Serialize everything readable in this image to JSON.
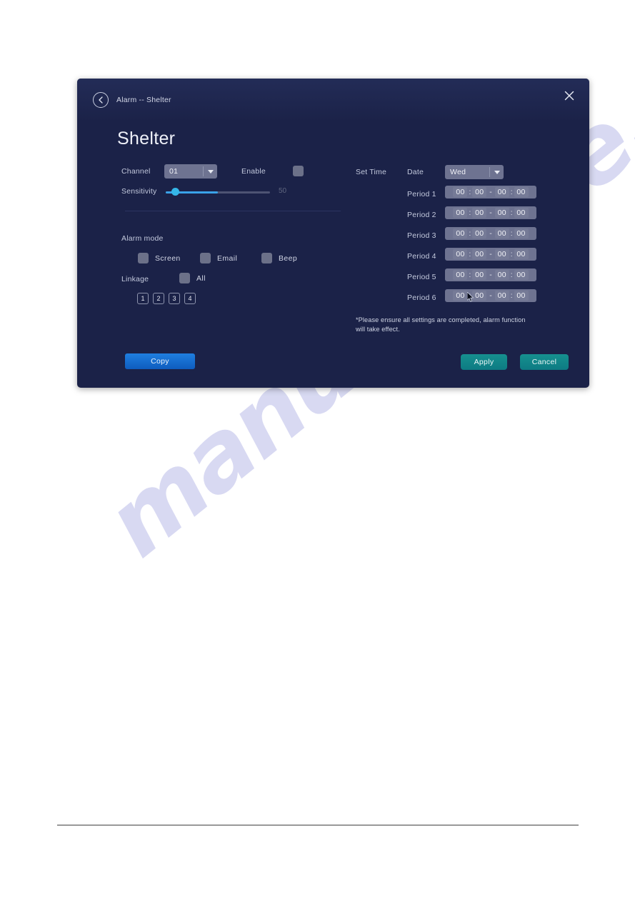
{
  "dialog": {
    "breadcrumb": "Alarm -- Shelter",
    "title": "Shelter",
    "back_icon": "chevron-left-icon",
    "close_icon": "close-icon"
  },
  "left": {
    "channel_label": "Channel",
    "channel_value": "01",
    "enable_label": "Enable",
    "enable_checked": false,
    "sensitivity_label": "Sensitivity",
    "sensitivity_value": "50",
    "alarm_mode_label": "Alarm mode",
    "modes": [
      {
        "label": "Screen",
        "checked": false
      },
      {
        "label": "Email",
        "checked": false
      },
      {
        "label": "Beep",
        "checked": false
      }
    ],
    "linkage_label": "Linkage",
    "linkage_all_label": "All",
    "linkage_all_checked": false,
    "channel_buttons": [
      "1",
      "2",
      "3",
      "4"
    ],
    "copy_label": "Copy"
  },
  "right": {
    "set_time_label": "Set Time",
    "date_label": "Date",
    "date_value": "Wed",
    "periods": [
      {
        "label": "Period 1",
        "start_h": "00",
        "start_m": "00",
        "end_h": "00",
        "end_m": "00"
      },
      {
        "label": "Period 2",
        "start_h": "00",
        "start_m": "00",
        "end_h": "00",
        "end_m": "00"
      },
      {
        "label": "Period 3",
        "start_h": "00",
        "start_m": "00",
        "end_h": "00",
        "end_m": "00"
      },
      {
        "label": "Period 4",
        "start_h": "00",
        "start_m": "00",
        "end_h": "00",
        "end_m": "00"
      },
      {
        "label": "Period 5",
        "start_h": "00",
        "start_m": "00",
        "end_h": "00",
        "end_m": "00"
      },
      {
        "label": "Period 6",
        "start_h": "00",
        "start_m": "00",
        "end_h": "00",
        "end_m": "00"
      }
    ],
    "time_separator": ":",
    "range_dash": "-",
    "note": "*Please ensure all settings are completed, alarm function will take effect.",
    "apply_label": "Apply",
    "cancel_label": "Cancel"
  },
  "page": {
    "watermark": "manualshive.com"
  },
  "colors": {
    "dialog_bg": "#1b2248",
    "field_bg": "#6e7391",
    "accent_blue": "#1f7fe0",
    "accent_teal": "#16908f",
    "slider_fill": "#3aa2e8",
    "watermark": "#b9bbe8"
  }
}
